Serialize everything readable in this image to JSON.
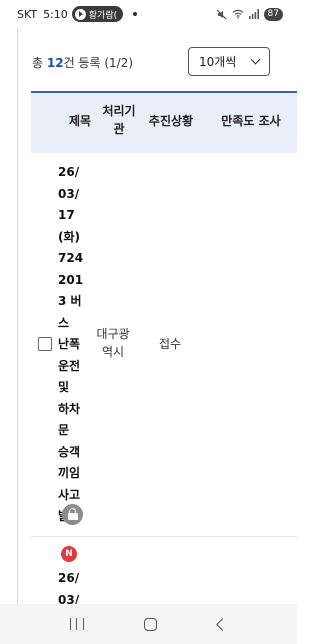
{
  "status_bar": {
    "carrier": "SKT",
    "time": "5:10",
    "notification_label": "황가람(",
    "battery": "87"
  },
  "list": {
    "count_prefix": "총",
    "count_value": "12",
    "count_suffix": "건 등록 (1/2)",
    "per_page": "10개씩"
  },
  "table": {
    "headers": {
      "title": "제목",
      "agency": [
        "처리기",
        "관"
      ],
      "status": "추진상황",
      "satisfaction": "만족도 조사"
    },
    "rows": [
      {
        "title_lines": [
          "26/",
          "03/",
          "17",
          "(화)",
          "724",
          "201",
          "3 버",
          "스",
          "난폭",
          "운전",
          "및",
          "하차",
          "문",
          "승객",
          "끼임",
          "사고",
          "발생"
        ],
        "agency_lines": [
          "대구광",
          "역시"
        ],
        "status": "접수",
        "locked": true
      },
      {
        "badge": "N",
        "title_lines": [
          "26/",
          "03/"
        ]
      }
    ]
  },
  "icons": {
    "lock": "lock-icon",
    "new": "new-badge-icon",
    "dropdown": "chevron-down-icon"
  },
  "colors": {
    "accent": "#1b4fb0",
    "header_bg": "#e9eef8",
    "header_border": "#3d62b3",
    "new_badge": "#e0393e"
  }
}
